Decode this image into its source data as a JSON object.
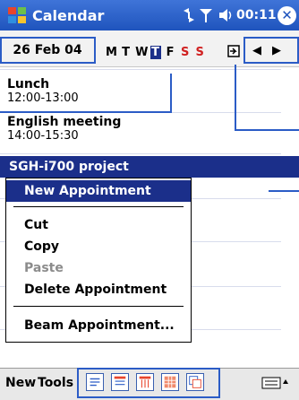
{
  "titlebar": {
    "title": "Calendar",
    "clock": "00:11",
    "close": "✕"
  },
  "datebar": {
    "date": "26 Feb 04",
    "weekdays": [
      "M",
      "T",
      "W",
      "T",
      "F",
      "S",
      "S"
    ],
    "selected_index": 3,
    "prev": "◀",
    "next": "▶"
  },
  "appointments": [
    {
      "title": "Lunch",
      "time": "12:00-13:00"
    },
    {
      "title": "English meeting",
      "time": "14:00-15:30"
    }
  ],
  "selected_appointment": "SGH-i700 project",
  "context_menu": {
    "items": [
      {
        "label": "New Appointment",
        "state": "highlighted"
      },
      {
        "label": "Cut",
        "state": "normal"
      },
      {
        "label": "Copy",
        "state": "normal"
      },
      {
        "label": "Paste",
        "state": "disabled"
      },
      {
        "label": "Delete Appointment",
        "state": "normal"
      },
      {
        "label": "Beam Appointment...",
        "state": "normal"
      }
    ]
  },
  "bottombar": {
    "new_label": "New",
    "tools_label": "Tools"
  },
  "colors": {
    "titlebar": "#2b5cc6",
    "selection": "#1b2f8a",
    "weekend": "#d02020",
    "callout": "#2b5cc6"
  },
  "icons": [
    "windows-flag-icon",
    "connectivity-icon",
    "antenna-icon",
    "speaker-icon",
    "close-icon",
    "go-to-today-icon",
    "agenda-view-icon",
    "day-view-icon",
    "week-view-icon",
    "month-view-icon",
    "year-view-icon",
    "keyboard-icon"
  ]
}
